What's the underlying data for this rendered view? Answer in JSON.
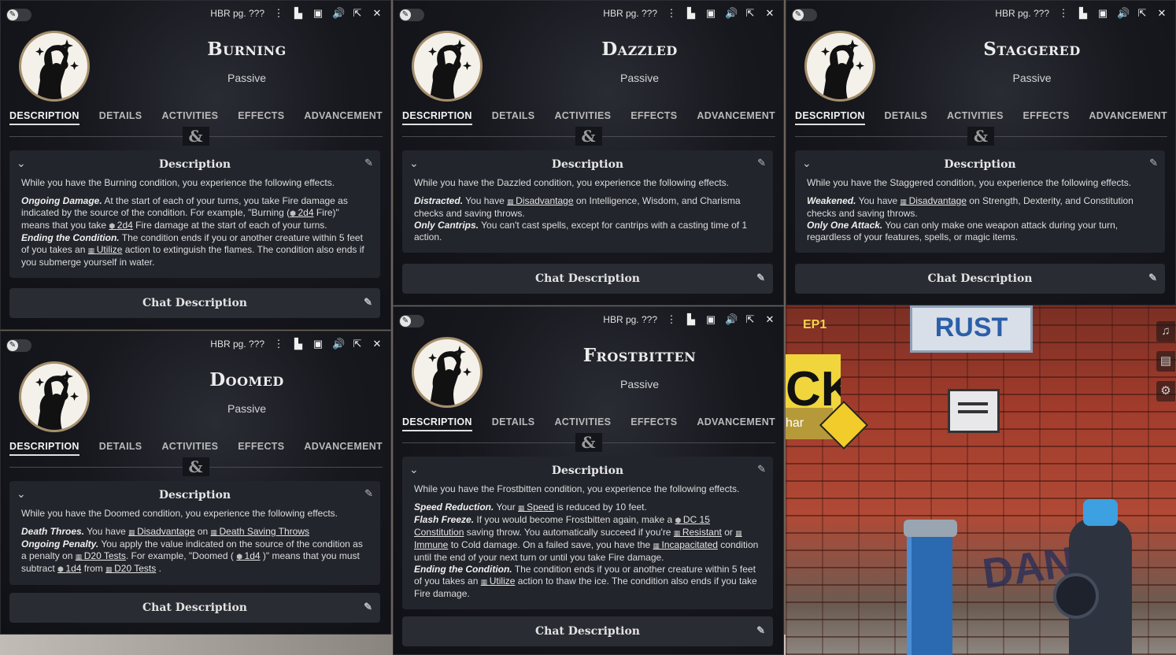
{
  "common": {
    "source": "HBR pg. ???",
    "subtype": "Passive",
    "tabs": [
      "DESCRIPTION",
      "DETAILS",
      "ACTIVITIES",
      "EFFECTS",
      "ADVANCEMENT"
    ],
    "divider_glyph": "&",
    "description_heading": "Description",
    "chat_heading": "Chat Description"
  },
  "burning": {
    "name": "Burning",
    "intro": "While you have the Burning condition, you experience the following effects.",
    "p1_title": "Ongoing Damage.",
    "p1_a": " At the start of each of your turns, you take Fire damage as indicated by the source of the condition. For example, \"Burning (",
    "p1_die1": "2d4",
    "p1_b": " Fire)\" means that you take ",
    "p1_die2": "2d4",
    "p1_c": " Fire damage at the start of each of your turns.",
    "p2_title": "Ending the Condition.",
    "p2_a": " The condition ends if you or another creature within 5 feet of you takes an ",
    "p2_ref": "Utilize",
    "p2_b": " action to extinguish the flames. The condition also ends if you submerge yourself in water."
  },
  "dazzled": {
    "name": "Dazzled",
    "intro": "While you have the Dazzled condition, you experience the following effects.",
    "p1_title": "Distracted.",
    "p1_a": " You have ",
    "p1_ref": "Disadvantage",
    "p1_b": " on Intelligence, Wisdom, and Charisma checks and saving throws.",
    "p2_title": "Only Cantrips.",
    "p2_a": " You can't cast spells, except for cantrips with a casting time of 1 action."
  },
  "staggered": {
    "name": "Staggered",
    "intro": "While you have the Staggered condition, you experience the following effects.",
    "p1_title": "Weakened.",
    "p1_a": " You have ",
    "p1_ref": "Disadvantage",
    "p1_b": " on Strength, Dexterity, and Constitution checks and saving throws.",
    "p2_title": "Only One Attack.",
    "p2_a": " You can only make one weapon attack during your turn, regardless of your features, spells, or magic items."
  },
  "doomed": {
    "name": "Doomed",
    "intro": "While you have the Doomed condition, you experience the following effects.",
    "p1_title": "Death Throes.",
    "p1_a": " You have ",
    "p1_ref1": "Disadvantage",
    "p1_b": " on ",
    "p1_ref2": "Death Saving Throws",
    "p2_title": "Ongoing Penalty.",
    "p2_a": " You apply the value indicated on the source of the condition as a penalty on ",
    "p2_ref1": "D20 Tests",
    "p2_b": ". For example, \"Doomed ( ",
    "p2_die1": "1d4",
    "p2_c": " )\" means that you must subtract ",
    "p2_die2": "1d4",
    "p2_d": " from ",
    "p2_ref2": "D20 Tests",
    "p2_e": " ."
  },
  "frostbitten": {
    "name": "Frostbitten",
    "intro": "While you have the Frostbitten condition, you experience the following effects.",
    "p1_title": "Speed Reduction.",
    "p1_a": " Your ",
    "p1_ref": "Speed",
    "p1_b": " is reduced by 10 feet.",
    "p2_title": "Flash Freeze.",
    "p2_a": " If you would become Frostbitten again, make a ",
    "p2_die": "DC 15 Constitution",
    "p2_b": " saving throw. You automatically succeed if you're ",
    "p2_ref1": "Resistant",
    "p2_c": " or ",
    "p2_ref2": "Immune",
    "p2_d": " to Cold damage. On a failed save, you have the ",
    "p2_ref3": "Incapacitated",
    "p2_e": " condition until the end of your next turn or until you take Fire damage.",
    "p3_title": "Ending the Condition.",
    "p3_a": " The condition ends if you or another creature within 5 feet of you takes an ",
    "p3_ref": "Utilize",
    "p3_b": " action to thaw the ice. The condition also ends if you take Fire damage."
  },
  "scene": {
    "sign_text": "RUST",
    "tag_text": "EP1",
    "poster_text": "CK",
    "poster2_text": "har",
    "graffiti_text": "DANS"
  },
  "colors": {
    "window_bg": "#14151a",
    "card_bg": "#23252c",
    "portrait_border": "#a68f6c",
    "brick": "#a23c2c"
  },
  "icons": [
    "wrench-icon",
    "menu-dots-icon",
    "sheet-icon",
    "token-icon",
    "sound-icon",
    "popout-icon",
    "close-icon",
    "chevron-down-icon",
    "edit-icon",
    "music-icon",
    "journal-icon",
    "settings-icon"
  ]
}
